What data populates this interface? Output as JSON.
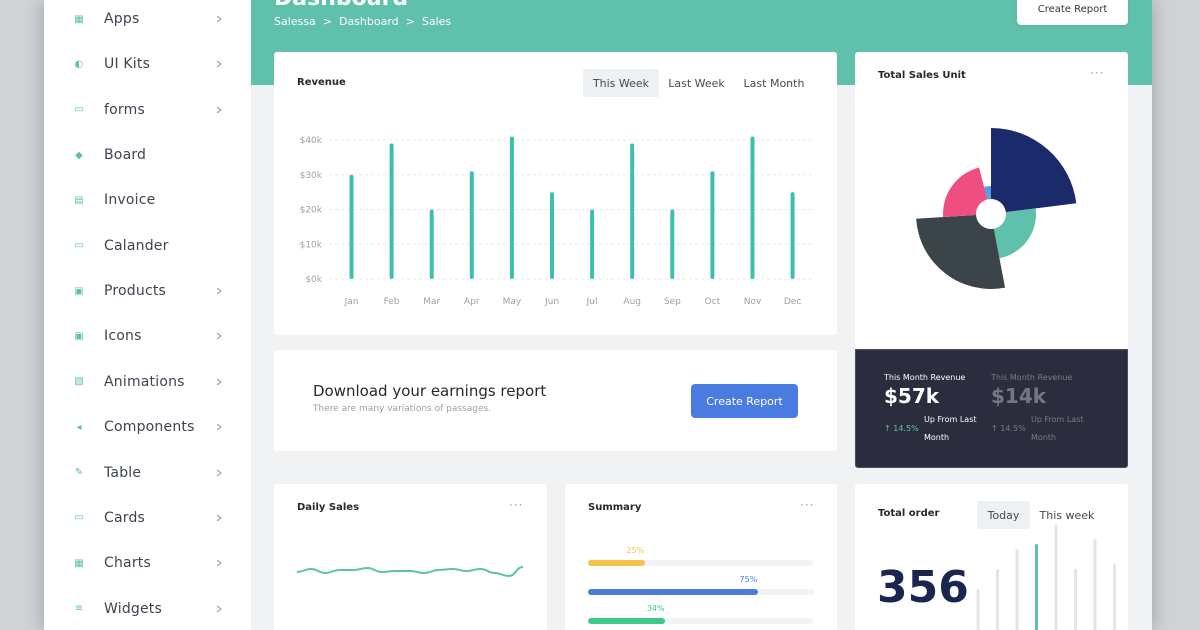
{
  "sidebar": {
    "items": [
      {
        "label": "Apps",
        "icon": "apps-grid-icon",
        "chevron": true
      },
      {
        "label": "UI Kits",
        "icon": "ui-kits-icon",
        "chevron": true
      },
      {
        "label": "forms",
        "icon": "forms-icon",
        "chevron": true
      },
      {
        "label": "Board",
        "icon": "board-icon",
        "chevron": false
      },
      {
        "label": "Invoice",
        "icon": "invoice-icon",
        "chevron": false
      },
      {
        "label": "Calander",
        "icon": "calendar-icon",
        "chevron": false
      },
      {
        "label": "Products",
        "icon": "products-icon",
        "chevron": true
      },
      {
        "label": "Icons",
        "icon": "icons-icon",
        "chevron": true
      },
      {
        "label": "Animations",
        "icon": "animations-icon",
        "chevron": true
      },
      {
        "label": "Components",
        "icon": "components-icon",
        "chevron": true
      },
      {
        "label": "Table",
        "icon": "table-icon",
        "chevron": true
      },
      {
        "label": "Cards",
        "icon": "cards-icon",
        "chevron": true
      },
      {
        "label": "Charts",
        "icon": "charts-icon",
        "chevron": true
      },
      {
        "label": "Widgets",
        "icon": "widgets-icon",
        "chevron": true
      }
    ]
  },
  "header": {
    "title": "Dashboard",
    "breadcrumb": [
      "Salessa",
      ">",
      "Dashboard",
      ">",
      "Sales"
    ],
    "create_report_label": "Create Report"
  },
  "revenue": {
    "title": "Revenue",
    "tabs": [
      "This Week",
      "Last Week",
      "Last Month"
    ],
    "active_tab": "This Week"
  },
  "earnings": {
    "title": "Download your earnings report",
    "subtitle": "There are many variations of passages.",
    "button_label": "Create Report"
  },
  "total_sales": {
    "title": "Total Sales Unit",
    "menu_icon": "more-dots-icon"
  },
  "month_revenue": [
    {
      "caption": "This Month Revenue",
      "value": "$57k",
      "change": "14.5%",
      "note": "Up From Last Month"
    },
    {
      "caption": "This Month Revenue",
      "value": "$14k",
      "change": "14.5%",
      "note": "Up From Last Month"
    }
  ],
  "daily_sales": {
    "title": "Daily Sales"
  },
  "summary": {
    "title": "Summary",
    "bars": [
      {
        "label": "25%",
        "value": 25,
        "color": "#f5c04b"
      },
      {
        "label": "75%",
        "value": 75,
        "color": "#4a7be0"
      },
      {
        "label": "34%",
        "value": 34,
        "color": "#3ec98a"
      }
    ]
  },
  "total_order": {
    "title": "Total order",
    "tabs": [
      "Today",
      "This week"
    ],
    "active_tab": "Today",
    "value": "356"
  },
  "colors": {
    "accent": "#5fc1ac",
    "primary_button": "#4a7be0",
    "dark_panel": "#2b2d3f"
  },
  "chart_data": [
    {
      "type": "bar",
      "title": "Revenue",
      "categories": [
        "Jan",
        "Feb",
        "Mar",
        "Apr",
        "May",
        "Jun",
        "Jul",
        "Aug",
        "Sep",
        "Oct",
        "Nov",
        "Dec"
      ],
      "values": [
        30,
        39,
        20,
        31,
        41,
        25,
        20,
        39,
        20,
        31,
        41,
        25
      ],
      "ytick_labels": [
        "$0k",
        "$10k",
        "$20k",
        "$30k",
        "$40k"
      ],
      "ylim": [
        0,
        40
      ],
      "grid": true,
      "color": "#3dbfb0"
    },
    {
      "type": "pie",
      "title": "Total Sales Unit",
      "series": [
        {
          "value": 23,
          "radius": 86,
          "color": "#1b2a6b"
        },
        {
          "value": 24,
          "radius": 45,
          "color": "#5fc1ac"
        },
        {
          "value": 27,
          "radius": 75,
          "color": "#3b4448"
        },
        {
          "value": 22,
          "radius": 48,
          "color": "#ef4f80"
        },
        {
          "value": 4,
          "radius": 28,
          "color": "#5b9be0"
        }
      ]
    },
    {
      "type": "line",
      "title": "Daily Sales",
      "values": [
        42,
        45,
        41,
        44,
        44,
        46,
        42,
        43,
        43,
        41,
        44,
        45,
        43,
        45,
        41,
        38,
        47
      ],
      "ylim": [
        0,
        100
      ],
      "color": "#5fc1ac"
    },
    {
      "type": "bar",
      "title": "Total order",
      "values": [
        55,
        75,
        95,
        100,
        120,
        75,
        105,
        80
      ],
      "highlight_index": 3,
      "color": "#e3e6e9",
      "highlight_color": "#5fc1ac"
    }
  ]
}
